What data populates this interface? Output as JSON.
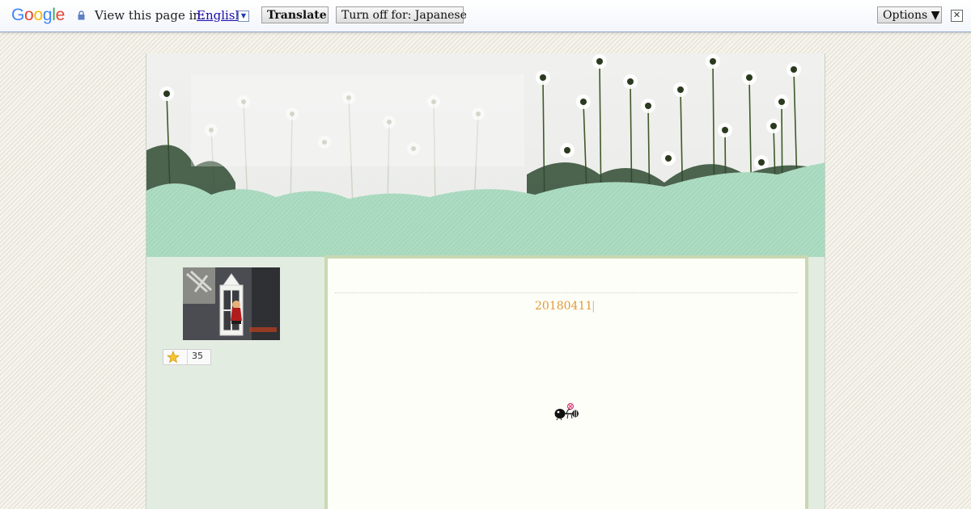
{
  "translate_bar": {
    "logo": {
      "letters": [
        "G",
        "o",
        "o",
        "g",
        "l",
        "e"
      ],
      "colors": [
        "#4285F4",
        "#EA4335",
        "#FBBC05",
        "#4285F4",
        "#34A853",
        "#EA4335"
      ]
    },
    "lock_icon": "lock-icon",
    "view_label": "View this page in:",
    "language": "English",
    "language_dropdown_icon": "chevron-down-icon",
    "translate_label": "Translate",
    "turn_off_label": "Turn off for: Japanese",
    "options_label": "Options ▼",
    "close_label": "✕"
  },
  "blog": {
    "sidebar": {
      "star_count": "35",
      "star_icon": "star-icon"
    },
    "post": {
      "date": "20180411",
      "separator": "|",
      "image_icon": "bee-icon"
    }
  },
  "colors": {
    "content_border": "#c9d8b3",
    "date_text": "#e09b3a",
    "grass": "#aedcc3",
    "frame_bg": "#e3ece1"
  }
}
